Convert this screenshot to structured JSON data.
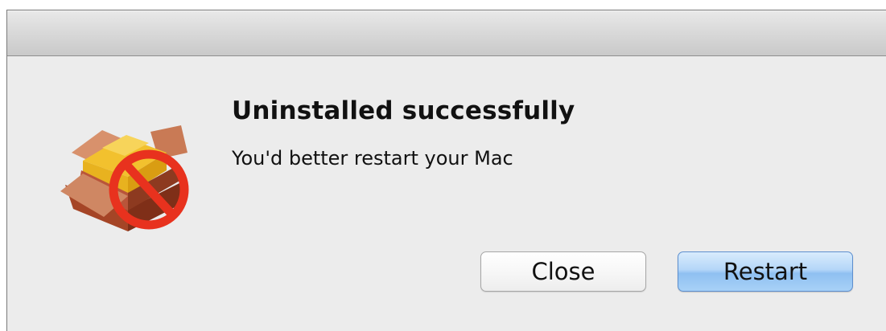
{
  "dialog": {
    "title": "Uninstalled successfully",
    "message": "You'd better restart your Mac",
    "icon": "package-prohibited-icon"
  },
  "buttons": {
    "close_label": "Close",
    "restart_label": "Restart"
  },
  "colors": {
    "window_background": "#ececec",
    "default_button": "#a8d1f7",
    "prohibited_sign": "#e8321e"
  }
}
